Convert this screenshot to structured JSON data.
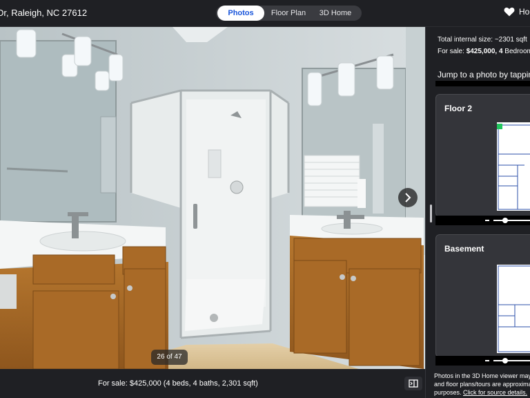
{
  "header": {
    "address": "Dr, Raleigh, NC 27612",
    "tabs": [
      {
        "label": "Photos",
        "active": true
      },
      {
        "label": "Floor Plan",
        "active": false
      },
      {
        "label": "3D Home",
        "active": false
      }
    ],
    "save_label": "Ho"
  },
  "photo": {
    "counter": "26 of 47",
    "next_icon": "chevron-right-icon"
  },
  "footer": {
    "summary": "For sale: $425,000 (4 beds, 4 baths, 2,301 sqft)",
    "panel_icon": "panel-toggle-icon"
  },
  "sidebar": {
    "size_line": "Total internal size: ~2301 sqft",
    "price_prefix": "For sale: ",
    "price_bold": "$425,000, 4",
    "price_suffix": " Bedroom",
    "jump_text": "Jump to a photo by tapping",
    "floors": [
      {
        "title": "Floor 2"
      },
      {
        "title": "Basement"
      }
    ],
    "disclaimer": {
      "line1": "Photos in the 3D Home viewer may",
      "line2": "and floor plans/tours are approxima",
      "line3_prefix": "purposes. ",
      "line3_link": "Click for source details."
    }
  },
  "colors": {
    "background": "#1f2024",
    "tab_active_text": "#1a56db",
    "plan_marker": "#22c55e"
  }
}
